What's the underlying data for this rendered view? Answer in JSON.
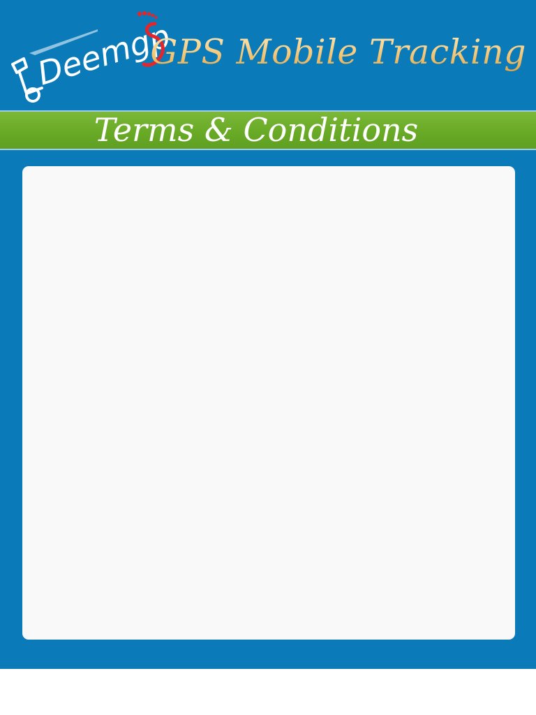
{
  "header": {
    "logo_alt": "Deemgps",
    "title": "GPS Mobile Tracking"
  },
  "title_bar": {
    "label": "Terms & Conditions"
  },
  "content": {
    "text": ""
  },
  "colors": {
    "background": "#0b7ab9",
    "title_bar": "#6aab27",
    "panel": "#f9f9f9",
    "logo_accent": "#e3262b",
    "title_gold": "#f4c878"
  },
  "icons": {
    "logo": "deemgps-logo"
  }
}
